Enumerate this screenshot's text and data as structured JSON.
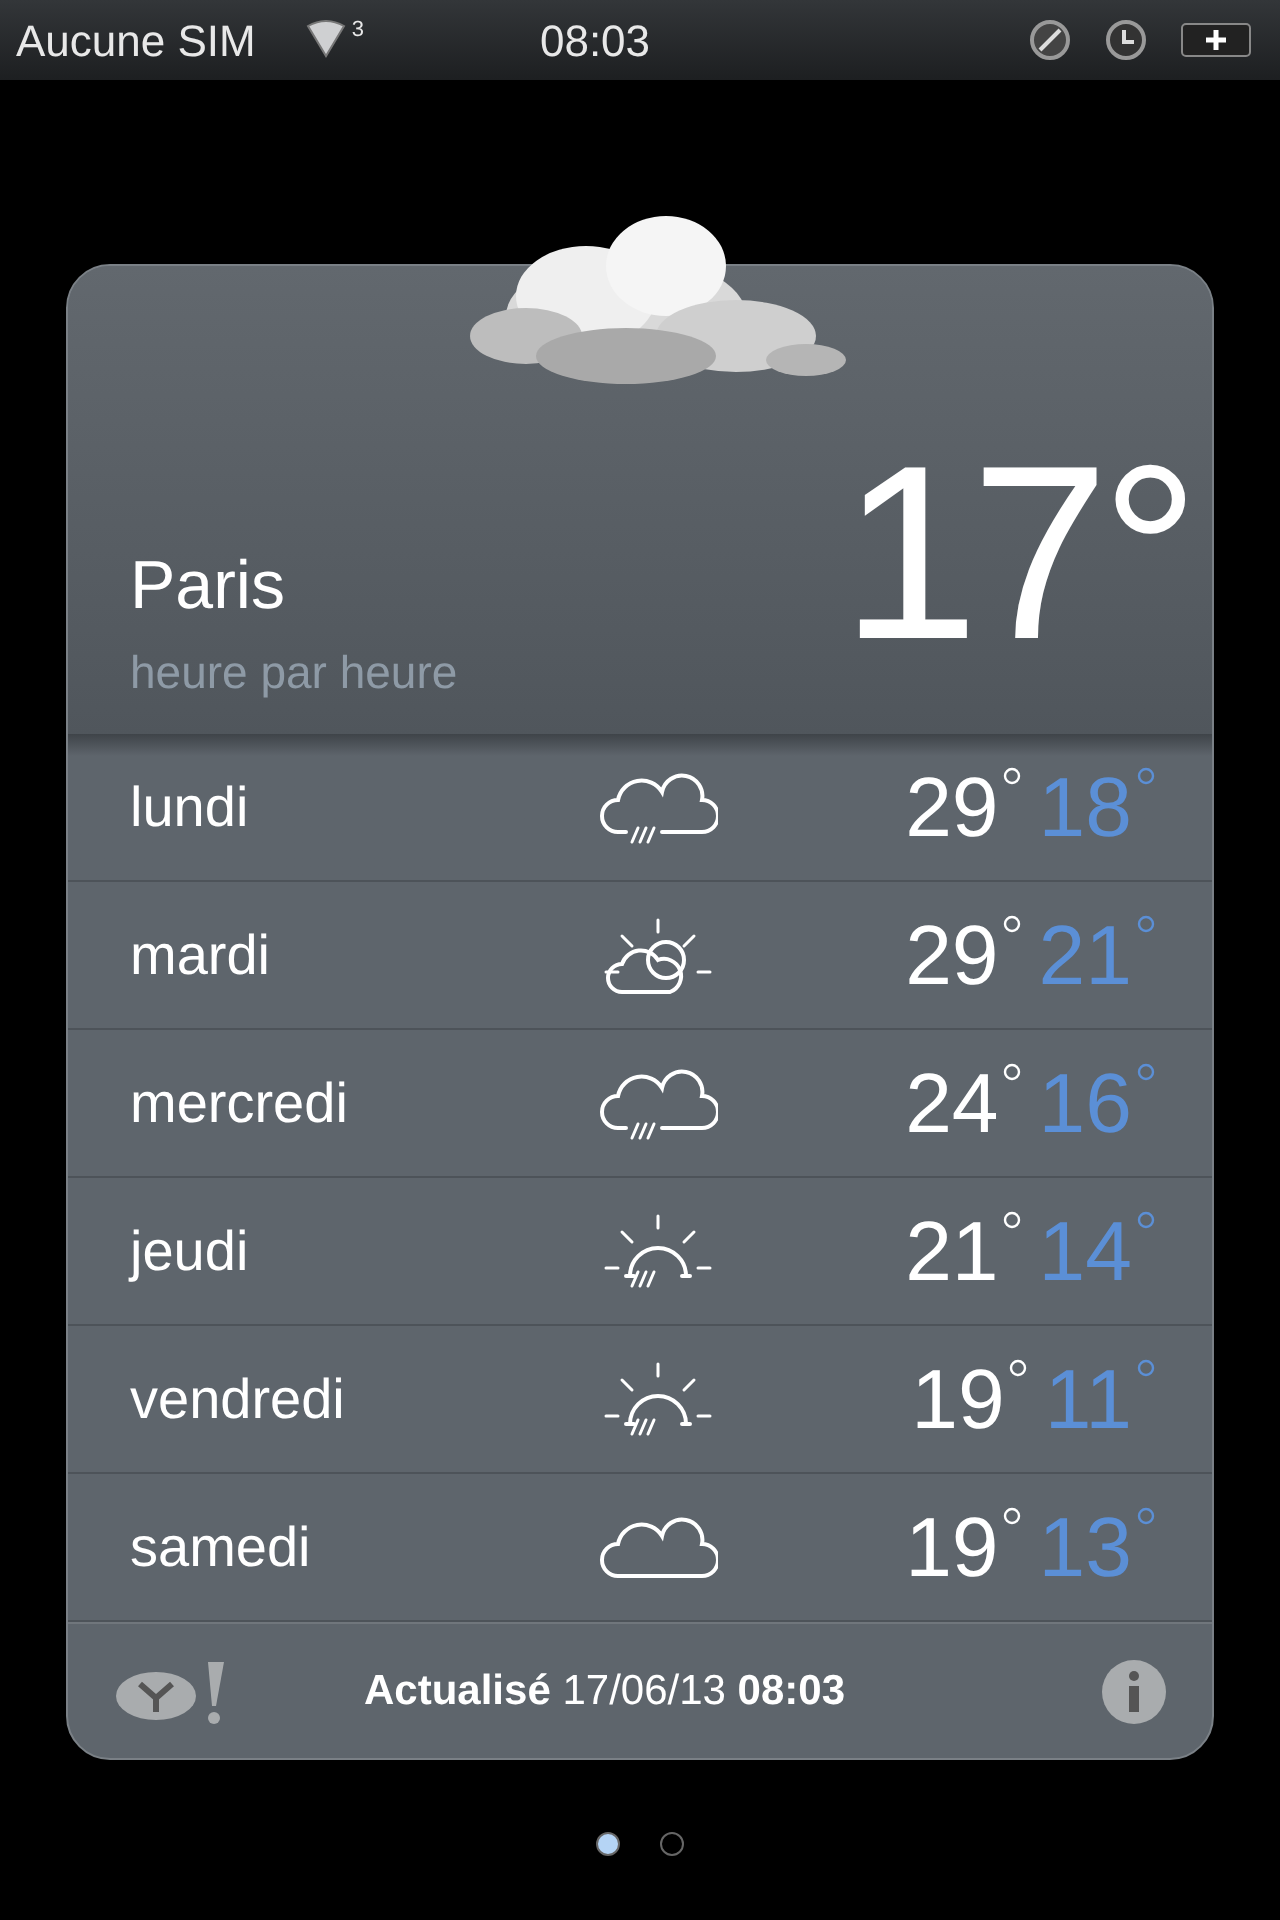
{
  "status_bar": {
    "carrier": "Aucune SIM",
    "signal_badge": "3",
    "time": "08:03"
  },
  "weather": {
    "city": "Paris",
    "subtitle": "heure par heure",
    "temperature": "17°",
    "days": [
      {
        "day": "lundi",
        "kind": "rain",
        "high": "29",
        "low": "18"
      },
      {
        "day": "mardi",
        "kind": "sun-cloud",
        "high": "29",
        "low": "21"
      },
      {
        "day": "mercredi",
        "kind": "rain",
        "high": "24",
        "low": "16"
      },
      {
        "day": "jeudi",
        "kind": "sun-rain",
        "high": "21",
        "low": "14"
      },
      {
        "day": "vendredi",
        "kind": "sun-rain",
        "high": "19",
        "low": "11"
      },
      {
        "day": "samedi",
        "kind": "cloud",
        "high": "19",
        "low": "13"
      }
    ],
    "updated": "**Actualisé** 17/06/13 **08:03**"
  },
  "page_dots": [
    {
      "selected": true
    },
    {
      "selected": false
    }
  ]
}
